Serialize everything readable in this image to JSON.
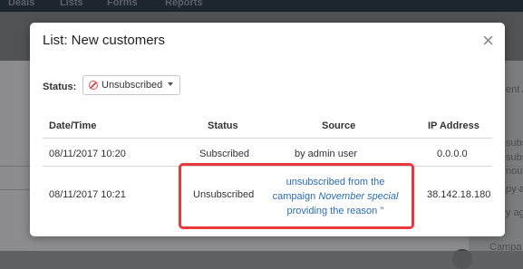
{
  "nav": [
    "Deals",
    "Lists",
    "Forms",
    "Reports"
  ],
  "background": {
    "right_snippets": [
      "ent A",
      "subsc",
      "subsc",
      "nouti",
      "py ag",
      "y ag",
      "Campa"
    ]
  },
  "modal": {
    "title": "List: New customers",
    "close_label": "×",
    "status_label": "Status:",
    "status_value": "Unsubscribed",
    "columns": [
      "Date/Time",
      "Status",
      "Source",
      "IP Address"
    ],
    "rows": [
      {
        "datetime": "08/11/2017 10:20",
        "status": "Subscribed",
        "source": "by admin user",
        "ip": "0.0.0.0"
      },
      {
        "datetime": "08/11/2017 10:21",
        "status": "Unsubscribed",
        "source_line1": "unsubscribed from the",
        "source_line2_prefix": "campaign ",
        "source_campaign": "November special",
        "source_line3": "providing the reason ''",
        "ip": "38.142.18.180"
      }
    ]
  },
  "colors": {
    "nav_bg": "#1c2b37",
    "link": "#2a6db5",
    "highlight": "#e8383d",
    "unsubscribed_icon": "#d9534f"
  }
}
